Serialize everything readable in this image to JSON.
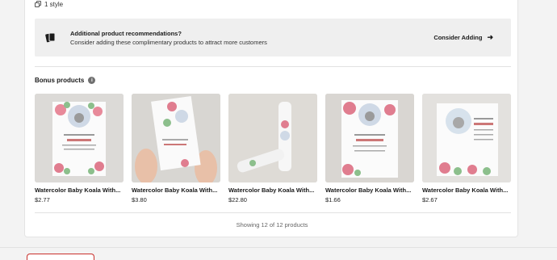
{
  "style_count": "1 style",
  "banner": {
    "title": "Additional product recommendations?",
    "subtitle": "Consider adding these complimentary products to attract more customers",
    "action": "Consider Adding"
  },
  "bonus": {
    "title": "Bonus products"
  },
  "products": [
    {
      "name": "Watercolor Baby Koala With...",
      "price": "$2.77"
    },
    {
      "name": "Watercolor Baby Koala With...",
      "price": "$3.80"
    },
    {
      "name": "Watercolor Baby Koala With...",
      "price": "$22.80"
    },
    {
      "name": "Watercolor Baby Koala With...",
      "price": "$1.66"
    },
    {
      "name": "Watercolor Baby Koala With...",
      "price": "$2.67"
    }
  ],
  "showing": "Showing 12 of 12 products",
  "colors": {
    "accent_red": "#c9302c",
    "banner_bg": "#efefef"
  }
}
